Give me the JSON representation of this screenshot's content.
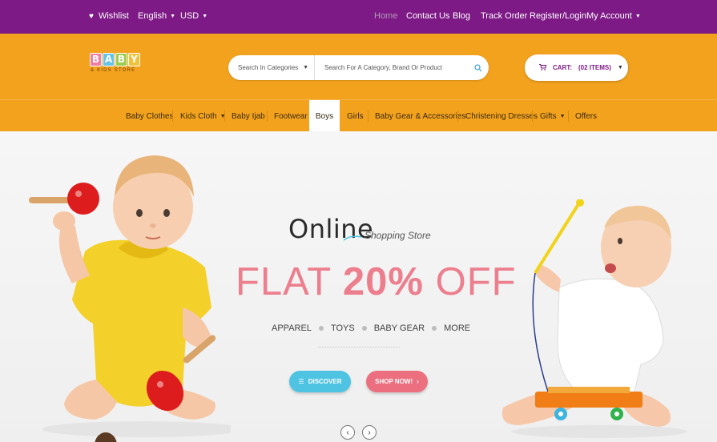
{
  "topbar": {
    "wishlist": "Wishlist",
    "language": "English",
    "currency": "USD",
    "links": [
      "Home",
      "Contact Us",
      "Blog",
      "Track Order",
      "Register/Login"
    ],
    "account": "My Account"
  },
  "logo": {
    "letters": [
      "B",
      "A",
      "B",
      "Y"
    ],
    "tagline": "& KIDS STORE"
  },
  "search": {
    "category_placeholder": "Search In Categories",
    "query_placeholder": "Search For A Category, Brand Or Product"
  },
  "cart": {
    "label": "CART:",
    "items": "(02 ITEMS)"
  },
  "nav": {
    "items": [
      "Baby Clothes",
      "Kids Cloth",
      "Baby Ijab",
      "Footwear",
      "Boys",
      "Girls",
      "Baby Gear & Accessories",
      "Christening Dresses",
      "Gifts",
      "Offers"
    ],
    "active": "Boys"
  },
  "hero": {
    "online": "Online",
    "shopping": "Shopping Store",
    "flat": "FLAT",
    "percent": "20%",
    "off": "OFF",
    "categories": [
      "APPAREL",
      "TOYS",
      "BABY GEAR",
      "MORE"
    ],
    "discover": "DISCOVER",
    "shop_now": "SHOP NOW!"
  },
  "colors": {
    "topbar": "#7d1a86",
    "header": "#f3a21e",
    "promo_pink": "#ec7e8d",
    "discover_blue": "#4fc4e2",
    "shop_pink": "#ec6f7f"
  },
  "icons": {
    "wishlist": "heart-icon",
    "search": "search-icon",
    "cart": "cart-icon",
    "discover": "list-icon",
    "shop_now": "chevron-right-icon",
    "prev": "chevron-left-icon",
    "next": "chevron-right-icon"
  }
}
